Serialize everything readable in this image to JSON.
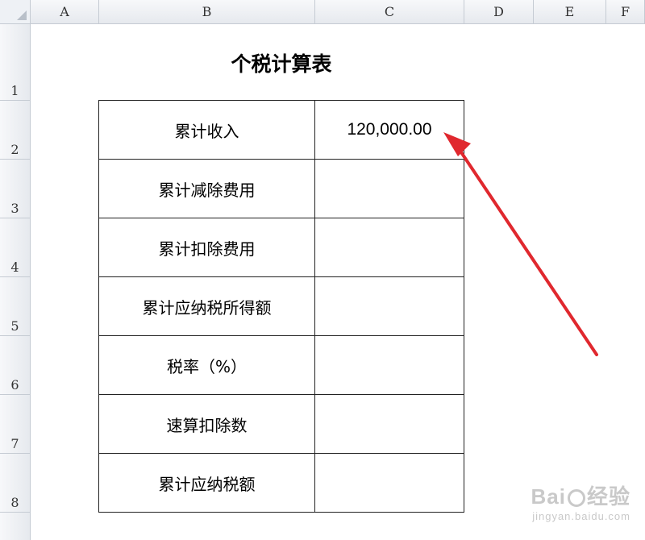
{
  "columns": [
    "A",
    "B",
    "C",
    "D",
    "E",
    "F"
  ],
  "rows": [
    "1",
    "2",
    "3",
    "4",
    "5",
    "6",
    "7",
    "8"
  ],
  "sheet": {
    "title": "个税计算表",
    "table": [
      {
        "label": "累计收入",
        "value": "120,000.00"
      },
      {
        "label": "累计减除费用",
        "value": ""
      },
      {
        "label": "累计扣除费用",
        "value": ""
      },
      {
        "label": "累计应纳税所得额",
        "value": ""
      },
      {
        "label": "税率（%）",
        "value": ""
      },
      {
        "label": "速算扣除数",
        "value": ""
      },
      {
        "label": "累计应纳税额",
        "value": ""
      }
    ]
  },
  "annotation": {
    "arrow_color": "#e0282e"
  },
  "watermark": {
    "brand_left": "Bai",
    "brand_right": "经验",
    "site": "jingyan.baidu.com"
  }
}
